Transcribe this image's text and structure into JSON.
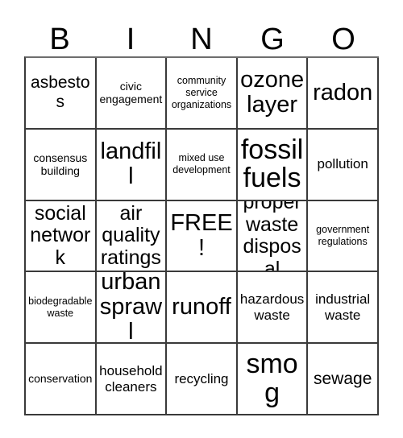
{
  "header": {
    "letters": [
      "B",
      "I",
      "N",
      "G",
      "O"
    ]
  },
  "grid": {
    "rows": 5,
    "columns": 5,
    "free_space_index": 12,
    "cells": [
      {
        "label": "asbestos",
        "size": "l"
      },
      {
        "label": "civic engagement",
        "size": "s"
      },
      {
        "label": "community service organizations",
        "size": "xs"
      },
      {
        "label": "ozone layer",
        "size": "2xl"
      },
      {
        "label": "radon",
        "size": "2xl"
      },
      {
        "label": "consensus building",
        "size": "s"
      },
      {
        "label": "landfill",
        "size": "2xl"
      },
      {
        "label": "mixed use development",
        "size": "xs"
      },
      {
        "label": "fossil fuels",
        "size": "3xl"
      },
      {
        "label": "pollution",
        "size": "m"
      },
      {
        "label": "social network",
        "size": "xl"
      },
      {
        "label": "air quality ratings",
        "size": "xl"
      },
      {
        "label": "FREE!",
        "size": "2xl"
      },
      {
        "label": "proper waste disposal",
        "size": "xl"
      },
      {
        "label": "government regulations",
        "size": "xs"
      },
      {
        "label": "biodegradable waste",
        "size": "xs"
      },
      {
        "label": "urban sprawl",
        "size": "2xl"
      },
      {
        "label": "runoff",
        "size": "2xl"
      },
      {
        "label": "hazardous waste",
        "size": "m"
      },
      {
        "label": "industrial waste",
        "size": "m"
      },
      {
        "label": "conservation",
        "size": "s"
      },
      {
        "label": "household cleaners",
        "size": "m"
      },
      {
        "label": "recycling",
        "size": "m"
      },
      {
        "label": "smog",
        "size": "3xl"
      },
      {
        "label": "sewage",
        "size": "l"
      }
    ]
  },
  "colors": {
    "background": "#ffffff",
    "text": "#000000",
    "grid_line": "#3a3a3a"
  }
}
